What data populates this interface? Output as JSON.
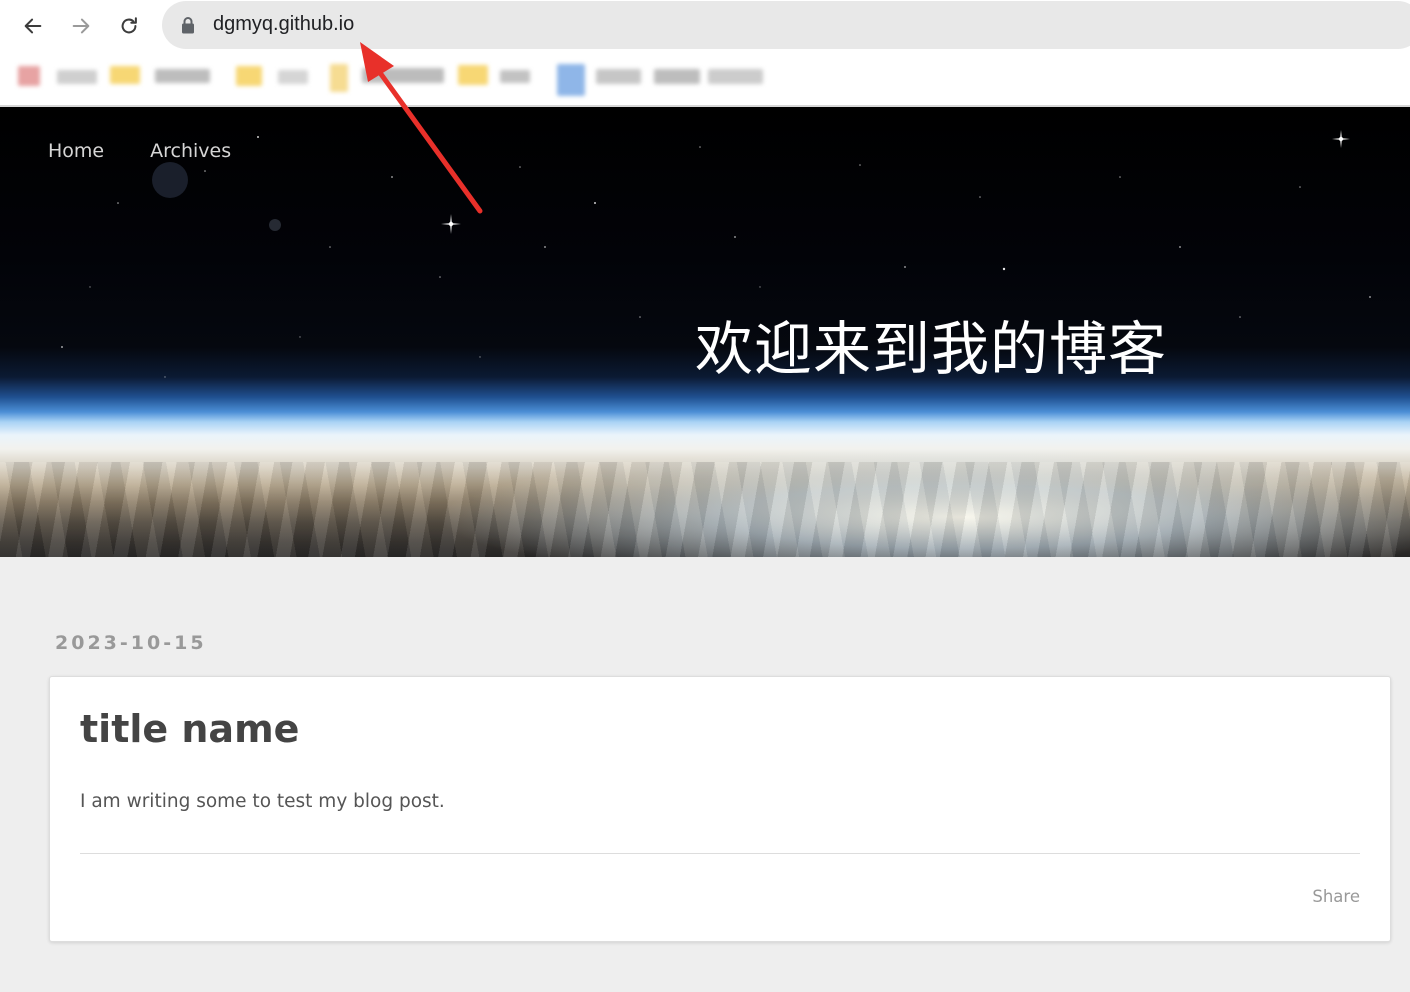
{
  "browser": {
    "url": "dgmyq.github.io",
    "icons": {
      "back": "arrow-left-icon",
      "forward": "arrow-right-icon",
      "reload": "reload-icon",
      "lock": "lock-icon"
    }
  },
  "site": {
    "nav": [
      {
        "label": "Home"
      },
      {
        "label": "Archives"
      }
    ],
    "hero_title": "欢迎来到我的博客"
  },
  "post": {
    "date": "2023-10-15",
    "title": "title name",
    "excerpt": "I am writing some to test my blog post.",
    "share_label": "Share"
  },
  "annotation": {
    "arrow_color": "#e8302a"
  }
}
